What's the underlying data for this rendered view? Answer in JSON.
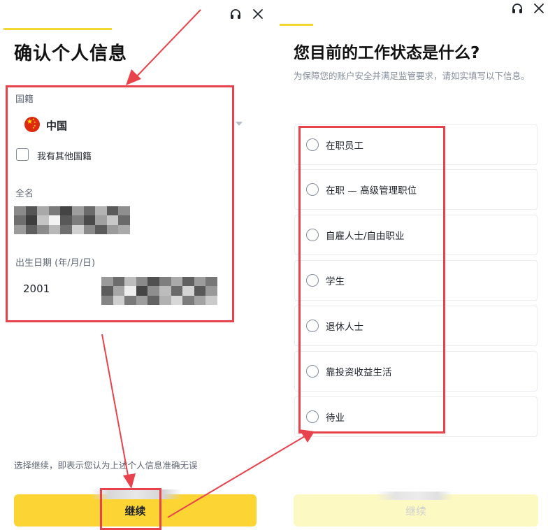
{
  "left_screen": {
    "title": "确认个人信息",
    "nationality": {
      "label": "国籍",
      "value": "中国",
      "flag_icon": "china-flag-icon"
    },
    "other_nationality_checkbox": {
      "label": "我有其他国籍",
      "checked": false
    },
    "full_name": {
      "label": "全名"
    },
    "dob": {
      "label": "出生日期 (年/月/日)",
      "year": "2001"
    },
    "disclaimer": "选择继续，即表示您认为上述个人信息准确无误",
    "continue_button": "继续"
  },
  "right_screen": {
    "title": "您目前的工作状态是什么?",
    "subtitle": "为保障您的账户安全并满足监管要求，请如实填写以下信息。",
    "options": [
      "在职员工",
      "在职 — 高级管理职位",
      "自雇人士/自由职业",
      "学生",
      "退休人士",
      "靠投资收益生活",
      "待业"
    ],
    "continue_button": "继续"
  },
  "header_icons": [
    "headset-icon",
    "close-icon"
  ],
  "colors": {
    "accent_yellow": "#fcd535",
    "disabled_yellow": "#fdf9c2",
    "annotation_red": "#e8434d",
    "progress_bar": "#f0d731"
  }
}
